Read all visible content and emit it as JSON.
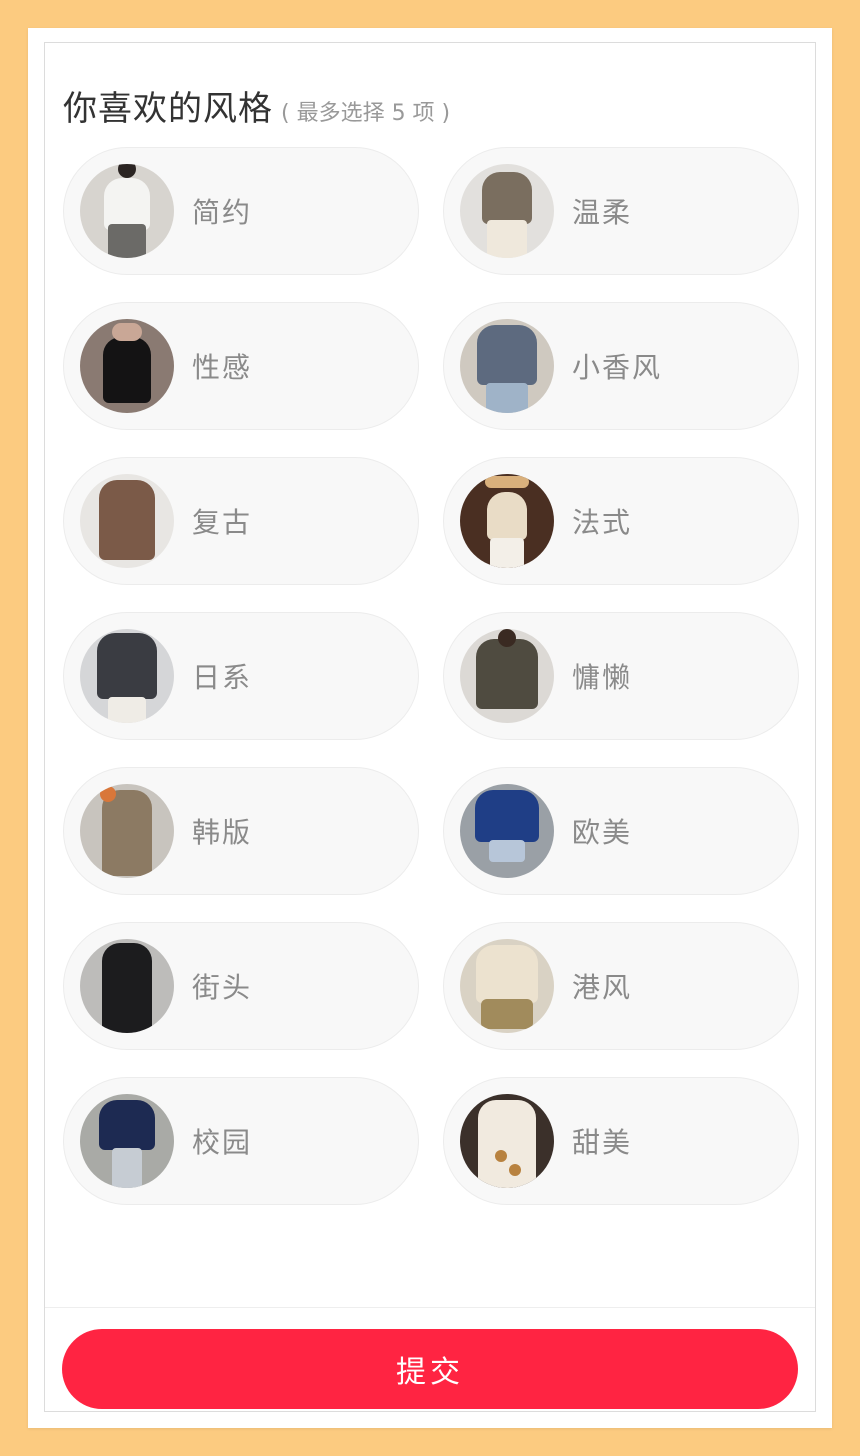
{
  "header": {
    "title": "你喜欢的风格",
    "hint": "( 最多选择 5 项 )"
  },
  "styles": [
    {
      "label": "简约",
      "photo_icon": "fashion-photo"
    },
    {
      "label": "温柔",
      "photo_icon": "fashion-photo"
    },
    {
      "label": "性感",
      "photo_icon": "fashion-photo"
    },
    {
      "label": "小香风",
      "photo_icon": "fashion-photo"
    },
    {
      "label": "复古",
      "photo_icon": "fashion-photo"
    },
    {
      "label": "法式",
      "photo_icon": "fashion-photo"
    },
    {
      "label": "日系",
      "photo_icon": "fashion-photo"
    },
    {
      "label": "慵懒",
      "photo_icon": "fashion-photo"
    },
    {
      "label": "韩版",
      "photo_icon": "fashion-photo"
    },
    {
      "label": "欧美",
      "photo_icon": "fashion-photo"
    },
    {
      "label": "街头",
      "photo_icon": "fashion-photo"
    },
    {
      "label": "港风",
      "photo_icon": "fashion-photo"
    },
    {
      "label": "校园",
      "photo_icon": "fashion-photo"
    },
    {
      "label": "甜美",
      "photo_icon": "fashion-photo"
    }
  ],
  "footer": {
    "submit_label": "提交"
  },
  "colors": {
    "page_background": "#fccb80",
    "accent": "#ff2442",
    "pill_background": "#f8f8f8",
    "label_text": "#8a8a8a"
  }
}
